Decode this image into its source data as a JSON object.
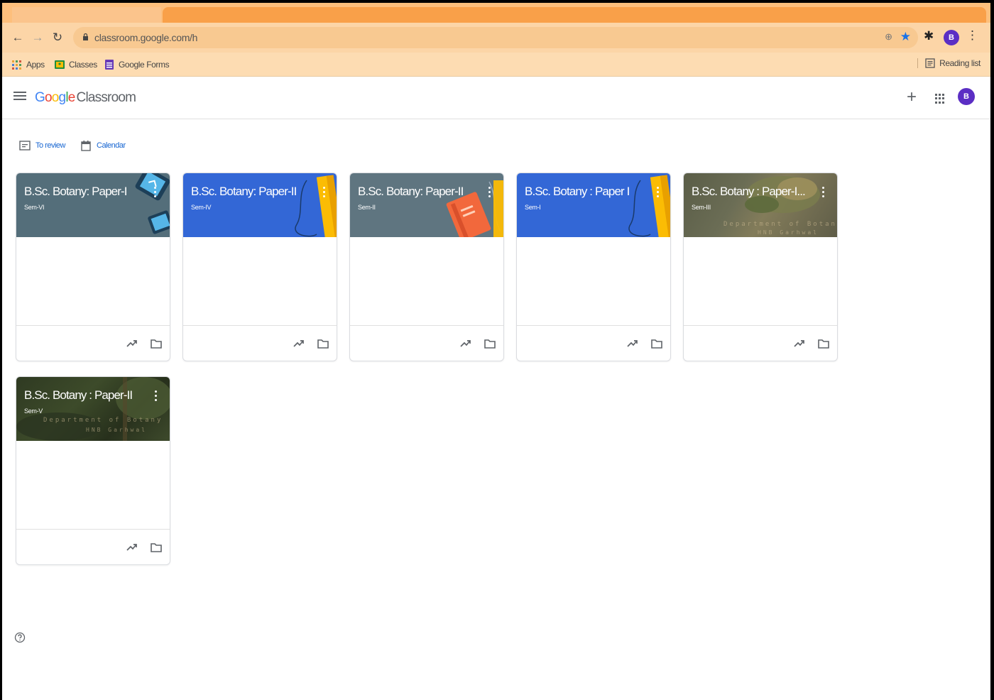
{
  "browser": {
    "url": "classroom.google.com/h",
    "profile_initial": "B",
    "bookmarks": [
      {
        "label": "Apps",
        "icon": "apps-grid-icon"
      },
      {
        "label": "Classes",
        "icon": "classroom-icon"
      },
      {
        "label": "Google Forms",
        "icon": "forms-icon"
      }
    ],
    "reading_list": "Reading list",
    "colors": {
      "chrome": "#fcd5a7",
      "tab": "#f9a049"
    }
  },
  "app": {
    "logo_google": "Google",
    "logo_product": "Classroom",
    "avatar_initial": "B",
    "quick_links": {
      "to_review": "To review",
      "calendar": "Calendar"
    }
  },
  "cards": [
    {
      "title": "B.Sc. Botany: Paper-I",
      "section": "Sem-VI",
      "theme": "grey",
      "theme_color": "#546e7a"
    },
    {
      "title": "B.Sc. Botany: Paper-II",
      "section": "Sem-IV",
      "theme": "blue",
      "theme_color": "#3367d6"
    },
    {
      "title": "B.Sc. Botany: Paper-II",
      "section": "Sem-II",
      "theme": "slate",
      "theme_color": "#5f7580"
    },
    {
      "title": "B.Sc. Botany : Paper I",
      "section": "Sem-I",
      "theme": "blue",
      "theme_color": "#3367d6"
    },
    {
      "title": "B.Sc. Botany : Paper-I...",
      "section": "Sem-III",
      "theme": "photo",
      "watermark": "Department of Botany",
      "watermark2": "HNB Garhwal"
    },
    {
      "title": "B.Sc. Botany : Paper-II",
      "section": "Sem-V",
      "theme": "forest",
      "watermark": "Department of Botany",
      "watermark2": "HNB Garhwal"
    }
  ]
}
